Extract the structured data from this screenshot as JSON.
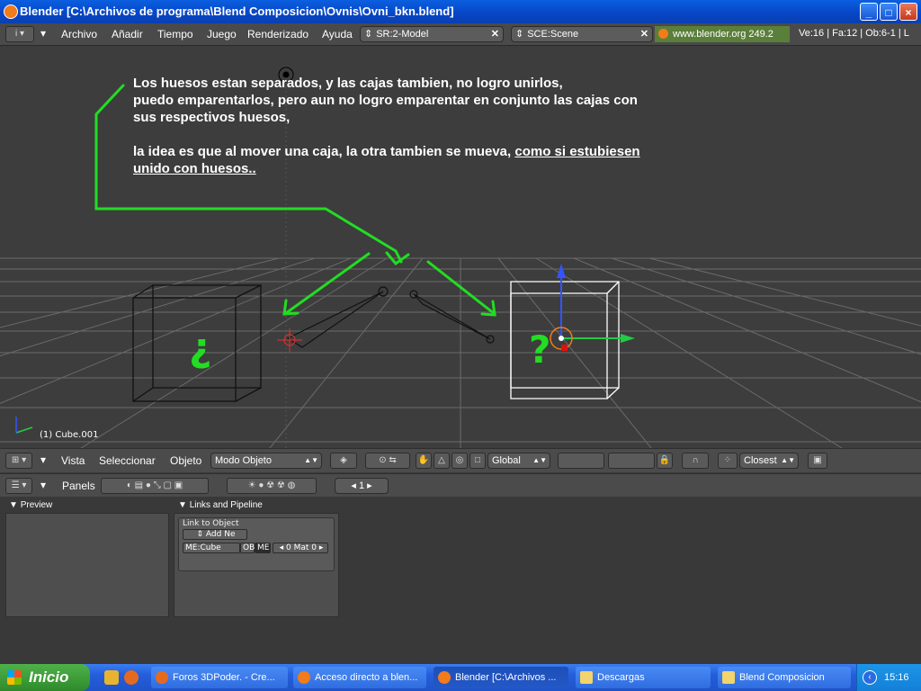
{
  "window": {
    "title": "Blender [C:\\Archivos de programa\\Blend Composicion\\Ovnis\\Ovni_bkn.blend]",
    "buttons": {
      "minimize": "_",
      "maximize": "□",
      "close": "×"
    }
  },
  "menubar": {
    "items": [
      "Archivo",
      "Añadir",
      "Tiempo",
      "Juego",
      "Renderizado",
      "Ayuda"
    ],
    "screen_field": "SR:2-Model",
    "scene_field": "SCE:Scene",
    "url": "www.blender.org 249.2",
    "stats": "Ve:16 | Fa:12 | Ob:6-1 | L"
  },
  "viewport": {
    "note_lines": [
      "Los huesos estan separados, y las cajas tambien, no logro unirlos,",
      "puedo emparentarlos, pero aun no logro emparentar en conjunto las cajas con",
      "sus respectivos huesos,"
    ],
    "note_line4_plain": "la idea es que al mover una caja, la otra tambien se mueva, ",
    "note_line4_underlined": "como si estubiesen",
    "note_line5_underlined": "unido con huesos..",
    "question_left": "¿",
    "question_right": "?",
    "object_label": "(1) Cube.001"
  },
  "view_header": {
    "menus": [
      "Vista",
      "Seleccionar",
      "Objeto"
    ],
    "mode": "Modo Objeto",
    "orientation": "Global",
    "snap": "Closest"
  },
  "buttons_window": {
    "panels_label": "Panels",
    "frame": "1",
    "preview_title": "Preview",
    "links_title": "Links and Pipeline",
    "link_to_object": "Link to Object",
    "add_new": "Add Ne",
    "mesh_name": "ME:Cube",
    "ob_label": "OB",
    "me_label": "ME",
    "mat": "0 Mat 0"
  },
  "taskbar": {
    "start": "Inicio",
    "tasks": [
      "Foros 3DPoder. - Cre...",
      "Acceso directo a blen...",
      "Blender [C:\\Archivos ...",
      "Descargas",
      "Blend Composicion"
    ],
    "clock": "15:16"
  },
  "colors": {
    "annotation_green": "#22dd22",
    "xp_blue": "#245edb",
    "blender_orange": "#f27b1c"
  }
}
